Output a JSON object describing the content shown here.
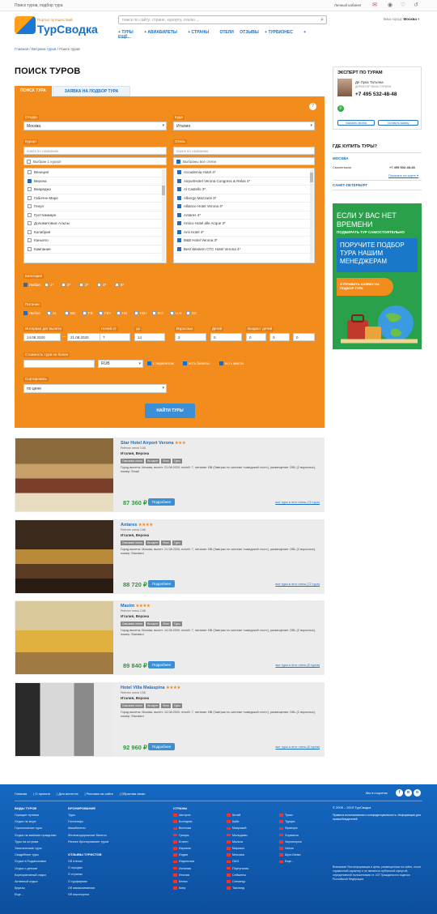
{
  "topbar": {
    "tagline": "Поиск туров, подбор тура",
    "account": "Личный кабинет",
    "notif_count": "1"
  },
  "logo": {
    "tagline": "Портал путешествий",
    "name": "ТурСводка"
  },
  "search": {
    "placeholder": "поиск по сайту: стране, курорту, отелю ..."
  },
  "city": {
    "label": "Ваш город:",
    "value": "Москва"
  },
  "nav": [
    "ТУРЫ",
    "АВИАБИЛЕТЫ",
    "СТРАНЫ",
    "ОТЕЛИ",
    "ОТЗЫВЫ",
    "ТУРБИЗНЕС",
    "ЕЩЁ..."
  ],
  "breadcrumbs": [
    "Главная",
    "Витрина туров",
    "Поиск туров"
  ],
  "page_title": "ПОИСК ТУРОВ",
  "tabs": [
    "ПОИСК ТУРА",
    "ЗАЯВКА НА ПОДБОР ТУРА"
  ],
  "form": {
    "from_label": "Откуда",
    "from_value": "Москва",
    "to_label": "Куда",
    "to_value": "Италия",
    "resort_label": "Курорт",
    "resort_search": "поиск по названию",
    "resort_selected": "Выбран 1 курорт",
    "resorts": [
      "Венеция",
      "Верона",
      "Виареджо",
      "Габичче-Маре",
      "Генуя",
      "Гроттаммаре",
      "Доломитовые Альпы",
      "Калабрия",
      "Каньяло",
      "Кампания"
    ],
    "hotel_label": "Отель",
    "hotel_search": "поиск по названию",
    "hotel_selected": "Выбраны все отели",
    "hotels": [
      "Accademia Hotel 4*",
      "AirportHotel Verona Congress & Relax 4*",
      "Al Castello 3*",
      "Albergo Mazzanti 3*",
      "Alliance Hotel Verona 4*",
      "Antares 4*",
      "Antico Hotel alle Acque 3*",
      "Arsi Hotel 4*",
      "B&B Hotel Verona 3*",
      "Best Western CTC Hotel Verona 4*"
    ],
    "category_label": "Категория",
    "categories": [
      "Любая",
      "1*",
      "2*",
      "3*",
      "4*",
      "5*"
    ],
    "meal_label": "Питание",
    "meals": [
      "Любое",
      "AI",
      "BB",
      "FB",
      "FB+",
      "HB",
      "HB+",
      "RO",
      "UAI",
      "SC"
    ],
    "dates_label": "Интервал дат вылета",
    "date_from": "14.08.2020",
    "date_to": "21.08.2020",
    "nights_from_label": "Ночей от",
    "nights_from": "7",
    "nights_to_label": "до",
    "nights_to": "14",
    "adults_label": "Взрослых",
    "adults": "2",
    "kids_label": "Детей",
    "kids": "0",
    "age_label": "Возраст детей",
    "ages": [
      "0",
      "0",
      "0"
    ],
    "price_label": "Стоимость тура не более",
    "price_value": "",
    "currency": "RUB",
    "opts": [
      "с перелетом",
      "есть билеты",
      "есть места"
    ],
    "sort_label": "Сортировать",
    "sort_value": "по цене",
    "submit": "НАЙТИ ТУРЫ"
  },
  "expert": {
    "title": "ЭКСПЕРТ ПО ТУРАМ",
    "name": "Де Лука Татьяна",
    "role": "ДИРЕКТОР ВИЗА ТУРИЗМ",
    "phone": "+7 495 532-48-48",
    "btn1": "Заказать звонок",
    "btn2": "Оставить заявку"
  },
  "where": {
    "title": "ГДЕ КУПИТЬ ТУРЫ?",
    "city1": "МОСКВА",
    "office": "Смоленская",
    "office_phone": "+7 495 532-48-48",
    "map_link": "Показать на карте",
    "city2": "САНКТ-ПЕТЕРБУРГ"
  },
  "banner": {
    "t1": "ЕСЛИ У ВАС НЕТ ВРЕМЕНИ",
    "t2": "ПОДБИРАТЬ ТУР САМОСТОЯТЕЛЬНО",
    "t3": "ПОРУЧИТЕ ПОДБОР ТУРА НАШИМ МЕНЕДЖЕРАМ",
    "btn": "ОТПРАВИТЬ ЗАЯВКУ НА ПОДБОР ТУРА"
  },
  "hotels": [
    {
      "name": "Star Hotel Airport Verona",
      "stars": "★★★",
      "rating": "Рейтинг отеля 3.88",
      "loc": "Италия, Верона",
      "tags": [
        "Описание отеля",
        "На карте",
        "Фото",
        "Туры"
      ],
      "desc": "Город вылета: Москва, вылет: 21.08.2020, ночей: 7, питание: BB (Завтрак по системе «шведский стол»), размещение: DBL (2 взрослых), номер: Small",
      "price": "87 360",
      "more": "Подробнее",
      "all": "все туры в этот отель (72 тура)"
    },
    {
      "name": "Antares",
      "stars": "★★★★",
      "rating": "Рейтинг отеля 3.88",
      "loc": "Италия, Верона",
      "tags": [
        "Описание отеля",
        "На карте",
        "Фото",
        "Туры"
      ],
      "desc": "Город вылета: Москва, вылет: 21.08.2020, ночей: 7, питание: BB (Завтрак по системе «шведский стол»), размещение: DBL (2 взрослых), номер: Standard",
      "price": "88 720",
      "more": "Подробнее",
      "all": "все туры в этот отель (72 тура)"
    },
    {
      "name": "Maxim",
      "stars": "★★★★",
      "rating": "Рейтинг отеля 2.88",
      "loc": "Италия, Верона",
      "tags": [
        "Описание отеля",
        "На карте",
        "Фото",
        "Туры"
      ],
      "desc": "Город вылета: Москва, вылет: 14.08.2020, ночей: 7, питание: BB (Завтрак по системе «шведский стол»), размещение: DBL (2 взрослых), номер: Standard",
      "price": "89 840",
      "more": "Подробнее",
      "all": "все туры в этот отель (8 туров)"
    },
    {
      "name": "Hotel Villa Malaspina",
      "stars": "★★★★",
      "rating": "Рейтинг отеля 3.88",
      "loc": "Италия, Верона",
      "tags": [
        "Описание отеля",
        "На карте",
        "Фото",
        "Туры"
      ],
      "desc": "Город вылета: Москва, вылет: 13.08.2020, ночей: 7, питание: BB (Завтрак по системе «шведский стол»), размещение: DBL (2 взрослых), номер: Standard",
      "price": "92 960",
      "more": "Подробнее",
      "all": "все туры в этот отель (8 туров)"
    }
  ],
  "footer": {
    "links": [
      "Главная",
      "О проекте",
      "Для агентств",
      "Реклама на сайте",
      "Обратная связь"
    ],
    "social_label": "Мы в соцсетях",
    "col1_title": "ВИДЫ ТУРОВ",
    "col1": [
      "Горящие путевки",
      "Отдых на море",
      "Горнолыжные туры",
      "Отдых на майские праздники",
      "Туры на острова",
      "Экзотические туры",
      "Свадебные туры",
      "Отдых в Подмосковье",
      "Отдых с детьми",
      "Корпоративный отдых",
      "Активный отдых",
      "Круизы",
      "Еще..."
    ],
    "col2_title": "БРОНИРОВАНИЕ",
    "col2": [
      "Туры",
      "Гостиницы",
      "Авиабилеты",
      "Железнодорожные билеты",
      "Раннее бронирование туров"
    ],
    "col2b_title": "ОТЗЫВЫ ТУРИСТОВ",
    "col2b": [
      "Об отелях",
      "О городах",
      "О странах",
      "О турфирмах",
      "Об авиакомпаниях",
      "Об аэропортах"
    ],
    "col3_title": "СТРАНЫ",
    "col3": [
      "Австрия",
      "Болгария",
      "Вьетнам",
      "Греция",
      "Египет",
      "Израиль",
      "Индия",
      "Индонезия",
      "Испания",
      "Италия",
      "Кения",
      "Кипр"
    ],
    "col4": [
      "Китай",
      "Куба",
      "Маврикий",
      "Мальдивы",
      "Мальта",
      "Марокко",
      "Мексика",
      "ОАЭ",
      "Португалия",
      "Сейшелы",
      "Сингапур",
      "Таиланд"
    ],
    "col5": [
      "Тунис",
      "Турция",
      "Франция",
      "Хорватия",
      "Черногория",
      "Чехия",
      "Шри-Ланка",
      "Еще..."
    ],
    "copy": "© 2005 – 2019 ТурСводка",
    "policy": "Правила использования и конфиденциальность. Информация для правообладателей",
    "legal": "Внимание! Вся информация и цены, размещенные на сайте, носят справочный характер и не являются публичной офертой, определяемой положениями ст. 437 Гражданского кодекса Российской Федерации."
  }
}
